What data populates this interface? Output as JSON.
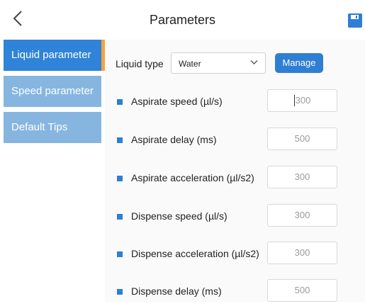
{
  "header": {
    "title": "Parameters"
  },
  "sidebar": {
    "items": [
      {
        "label": "Liquid parameter",
        "active": true
      },
      {
        "label": "Speed parameter",
        "active": false
      },
      {
        "label": "Default Tips",
        "active": false
      }
    ]
  },
  "liquid_type": {
    "label": "Liquid type",
    "value": "Water",
    "manage_label": "Manage"
  },
  "params": [
    {
      "label": "Aspirate speed (µl/s)",
      "value": "300"
    },
    {
      "label": "Aspirate delay (ms)",
      "value": "500"
    },
    {
      "label": "Aspirate acceleration (µl/s2)",
      "value": "300"
    },
    {
      "label": "Dispense speed (µl/s)",
      "value": "300"
    },
    {
      "label": "Dispense acceleration (µl/s2)",
      "value": "300"
    },
    {
      "label": "Dispense delay (ms)",
      "value": "500"
    }
  ],
  "colors": {
    "accent": "#2f83d8",
    "sidebar_inactive": "#86b6e0",
    "active_marker": "#f7a23b"
  },
  "icons": {
    "back": "chevron-left-icon",
    "save": "save-icon",
    "select": "chevron-down-icon"
  }
}
